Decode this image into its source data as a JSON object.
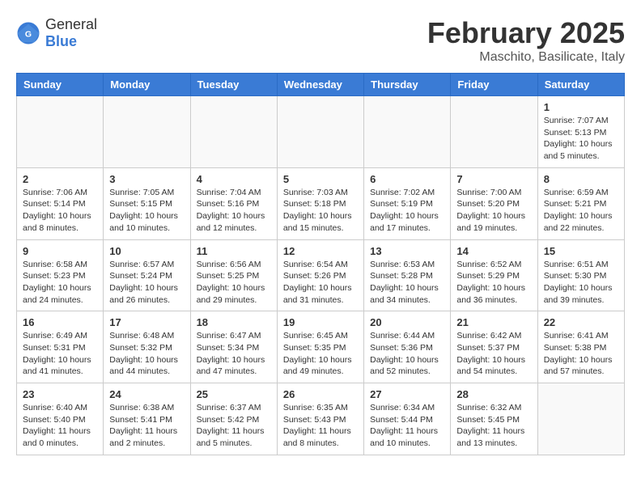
{
  "header": {
    "logo_general": "General",
    "logo_blue": "Blue",
    "title": "February 2025",
    "subtitle": "Maschito, Basilicate, Italy"
  },
  "weekdays": [
    "Sunday",
    "Monday",
    "Tuesday",
    "Wednesday",
    "Thursday",
    "Friday",
    "Saturday"
  ],
  "weeks": [
    [
      {
        "day": "",
        "info": ""
      },
      {
        "day": "",
        "info": ""
      },
      {
        "day": "",
        "info": ""
      },
      {
        "day": "",
        "info": ""
      },
      {
        "day": "",
        "info": ""
      },
      {
        "day": "",
        "info": ""
      },
      {
        "day": "1",
        "info": "Sunrise: 7:07 AM\nSunset: 5:13 PM\nDaylight: 10 hours\nand 5 minutes."
      }
    ],
    [
      {
        "day": "2",
        "info": "Sunrise: 7:06 AM\nSunset: 5:14 PM\nDaylight: 10 hours\nand 8 minutes."
      },
      {
        "day": "3",
        "info": "Sunrise: 7:05 AM\nSunset: 5:15 PM\nDaylight: 10 hours\nand 10 minutes."
      },
      {
        "day": "4",
        "info": "Sunrise: 7:04 AM\nSunset: 5:16 PM\nDaylight: 10 hours\nand 12 minutes."
      },
      {
        "day": "5",
        "info": "Sunrise: 7:03 AM\nSunset: 5:18 PM\nDaylight: 10 hours\nand 15 minutes."
      },
      {
        "day": "6",
        "info": "Sunrise: 7:02 AM\nSunset: 5:19 PM\nDaylight: 10 hours\nand 17 minutes."
      },
      {
        "day": "7",
        "info": "Sunrise: 7:00 AM\nSunset: 5:20 PM\nDaylight: 10 hours\nand 19 minutes."
      },
      {
        "day": "8",
        "info": "Sunrise: 6:59 AM\nSunset: 5:21 PM\nDaylight: 10 hours\nand 22 minutes."
      }
    ],
    [
      {
        "day": "9",
        "info": "Sunrise: 6:58 AM\nSunset: 5:23 PM\nDaylight: 10 hours\nand 24 minutes."
      },
      {
        "day": "10",
        "info": "Sunrise: 6:57 AM\nSunset: 5:24 PM\nDaylight: 10 hours\nand 26 minutes."
      },
      {
        "day": "11",
        "info": "Sunrise: 6:56 AM\nSunset: 5:25 PM\nDaylight: 10 hours\nand 29 minutes."
      },
      {
        "day": "12",
        "info": "Sunrise: 6:54 AM\nSunset: 5:26 PM\nDaylight: 10 hours\nand 31 minutes."
      },
      {
        "day": "13",
        "info": "Sunrise: 6:53 AM\nSunset: 5:28 PM\nDaylight: 10 hours\nand 34 minutes."
      },
      {
        "day": "14",
        "info": "Sunrise: 6:52 AM\nSunset: 5:29 PM\nDaylight: 10 hours\nand 36 minutes."
      },
      {
        "day": "15",
        "info": "Sunrise: 6:51 AM\nSunset: 5:30 PM\nDaylight: 10 hours\nand 39 minutes."
      }
    ],
    [
      {
        "day": "16",
        "info": "Sunrise: 6:49 AM\nSunset: 5:31 PM\nDaylight: 10 hours\nand 41 minutes."
      },
      {
        "day": "17",
        "info": "Sunrise: 6:48 AM\nSunset: 5:32 PM\nDaylight: 10 hours\nand 44 minutes."
      },
      {
        "day": "18",
        "info": "Sunrise: 6:47 AM\nSunset: 5:34 PM\nDaylight: 10 hours\nand 47 minutes."
      },
      {
        "day": "19",
        "info": "Sunrise: 6:45 AM\nSunset: 5:35 PM\nDaylight: 10 hours\nand 49 minutes."
      },
      {
        "day": "20",
        "info": "Sunrise: 6:44 AM\nSunset: 5:36 PM\nDaylight: 10 hours\nand 52 minutes."
      },
      {
        "day": "21",
        "info": "Sunrise: 6:42 AM\nSunset: 5:37 PM\nDaylight: 10 hours\nand 54 minutes."
      },
      {
        "day": "22",
        "info": "Sunrise: 6:41 AM\nSunset: 5:38 PM\nDaylight: 10 hours\nand 57 minutes."
      }
    ],
    [
      {
        "day": "23",
        "info": "Sunrise: 6:40 AM\nSunset: 5:40 PM\nDaylight: 11 hours\nand 0 minutes."
      },
      {
        "day": "24",
        "info": "Sunrise: 6:38 AM\nSunset: 5:41 PM\nDaylight: 11 hours\nand 2 minutes."
      },
      {
        "day": "25",
        "info": "Sunrise: 6:37 AM\nSunset: 5:42 PM\nDaylight: 11 hours\nand 5 minutes."
      },
      {
        "day": "26",
        "info": "Sunrise: 6:35 AM\nSunset: 5:43 PM\nDaylight: 11 hours\nand 8 minutes."
      },
      {
        "day": "27",
        "info": "Sunrise: 6:34 AM\nSunset: 5:44 PM\nDaylight: 11 hours\nand 10 minutes."
      },
      {
        "day": "28",
        "info": "Sunrise: 6:32 AM\nSunset: 5:45 PM\nDaylight: 11 hours\nand 13 minutes."
      },
      {
        "day": "",
        "info": ""
      }
    ]
  ]
}
